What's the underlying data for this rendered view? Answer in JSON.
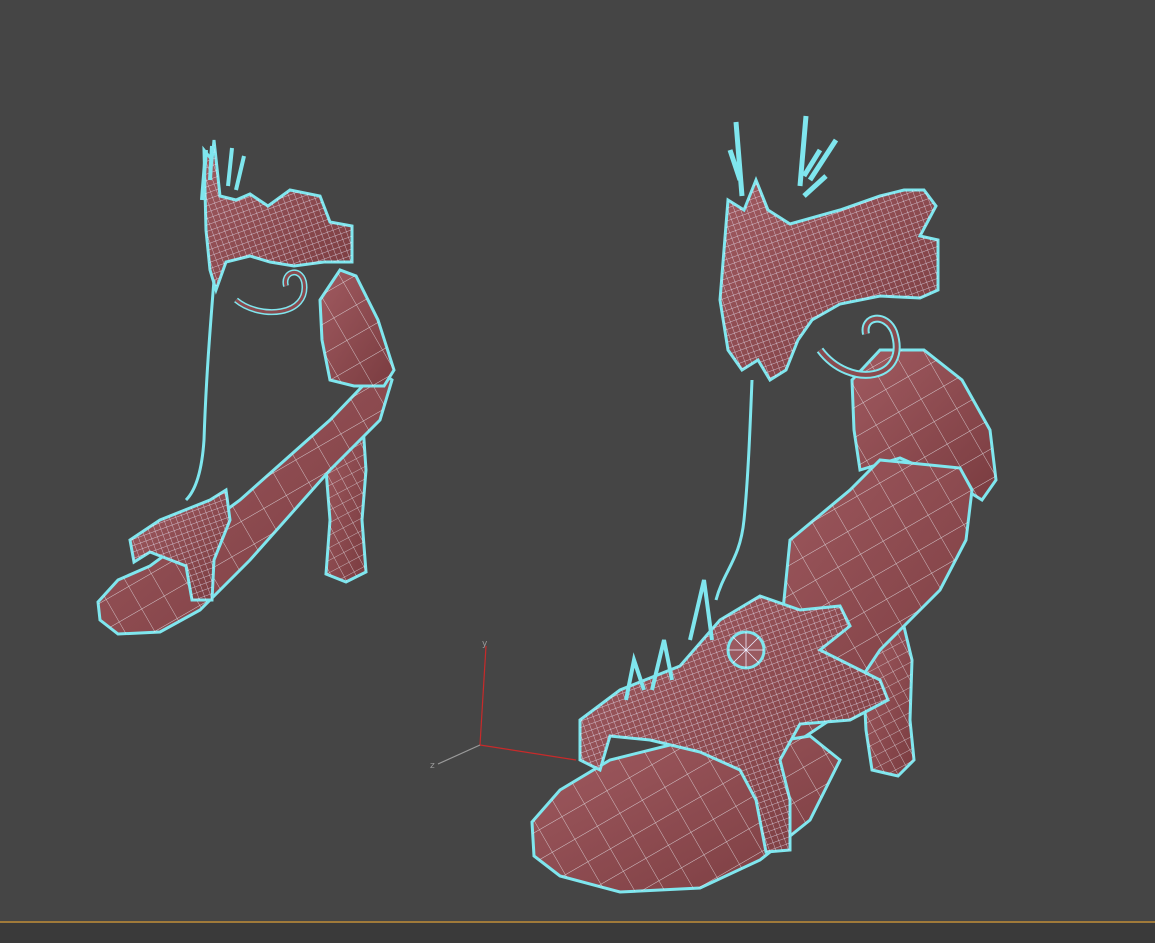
{
  "viewport": {
    "background_color": "#454545",
    "active_border_color": "#a07a3a"
  },
  "objects": [
    {
      "name": "shoe-left",
      "material_color": "#8a4a4e",
      "selection_color": "#7fe6ee"
    },
    {
      "name": "shoe-right",
      "material_color": "#8a4a4e",
      "selection_color": "#7fe6ee"
    }
  ],
  "axis_gizmo": {
    "x_label": "",
    "y_label": "y",
    "z_label": "z",
    "x_color": "#c82a2a",
    "y_color": "#c82a2a",
    "z_color": "#9a9a9a"
  }
}
